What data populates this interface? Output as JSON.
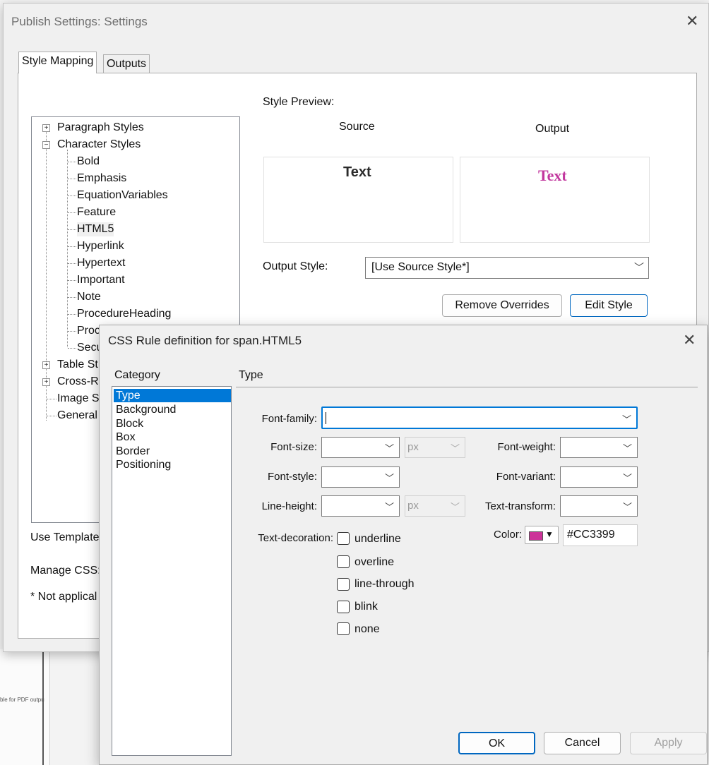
{
  "outer_dialog": {
    "title": "Publish Settings: Settings",
    "tabs": [
      "Style Mapping",
      "Outputs"
    ],
    "tree": {
      "paragraph_styles": "Paragraph Styles",
      "character_styles": "Character Styles",
      "children": [
        "Bold",
        "Emphasis",
        "EquationVariables",
        "Feature",
        "HTML5",
        "Hyperlink",
        "Hypertext",
        "Important",
        "Note",
        "ProcedureHeading",
        "Proc",
        "Secu"
      ],
      "table_styles": "Table St",
      "cross_ref": "Cross-R",
      "image": "Image S",
      "general": "General"
    },
    "style_preview_label": "Style Preview:",
    "source_label": "Source",
    "output_label": "Output",
    "source_text": "Text",
    "output_text": "Text",
    "output_style_label": "Output Style:",
    "output_style_value": "[Use Source Style*]",
    "remove_overrides": "Remove Overrides",
    "edit_style": "Edit Style",
    "use_template": "Use Template",
    "manage_css": "Manage CSS:",
    "not_applicable": "* Not applical"
  },
  "css_dialog": {
    "title": "CSS Rule definition for span.HTML5",
    "category_label": "Category",
    "section_label": "Type",
    "categories": [
      "Type",
      "Background",
      "Block",
      "Box",
      "Border",
      "Positioning"
    ],
    "font_family_label": "Font-family:",
    "font_size_label": "Font-size:",
    "font_weight_label": "Font-weight:",
    "font_style_label": "Font-style:",
    "font_variant_label": "Font-variant:",
    "line_height_label": "Line-height:",
    "text_transform_label": "Text-transform:",
    "text_decoration_label": "Text-decoration:",
    "color_label": "Color:",
    "color_value": "#CC3399",
    "unit_px": "px",
    "decorations": [
      "underline",
      "overline",
      "line-through",
      "blink",
      "none"
    ],
    "ok": "OK",
    "cancel": "Cancel",
    "apply": "Apply"
  },
  "background_fragments": {
    "pdf_note": "ble for PDF outpu"
  },
  "colors": {
    "accent": "#0078d7",
    "swatch": "#CC3399",
    "output_text": "#c2379e"
  },
  "icons": [
    "close-icon",
    "chevron-down-icon",
    "tree-expand-icon",
    "tree-collapse-icon",
    "color-swatch-icon"
  ]
}
